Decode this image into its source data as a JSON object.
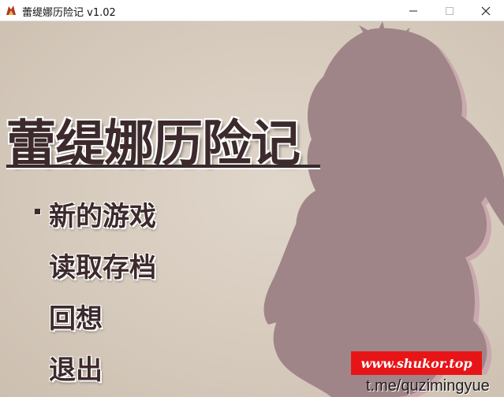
{
  "window": {
    "title": "蕾缇娜历险记 v1.02",
    "minimize_glyph": "—",
    "maximize_glyph": "☐",
    "close_glyph": "✕"
  },
  "game": {
    "title": "蕾缇娜历险记",
    "menu": [
      {
        "label": "新的游戏",
        "selected": true
      },
      {
        "label": "读取存档",
        "selected": false
      },
      {
        "label": "回想",
        "selected": false
      },
      {
        "label": "退出",
        "selected": false
      }
    ]
  },
  "watermark": {
    "site": "www.shukor.top",
    "link": "t.me/quzimingyue"
  },
  "colors": {
    "background": "#d7cbbd",
    "silhouette": "#a08588",
    "text": "#3d2a2c",
    "watermark_red": "#e81518"
  }
}
